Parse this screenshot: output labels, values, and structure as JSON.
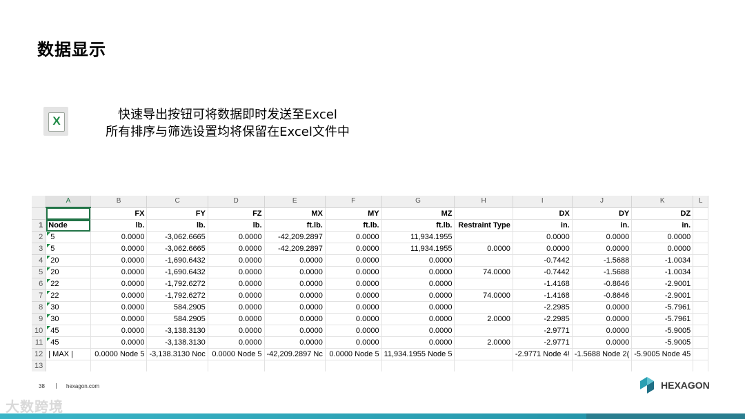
{
  "slide": {
    "title": "数据显示",
    "desc_line1": "快速导出按钮可将数据即时发送至Excel",
    "desc_line2": "所有排序与筛选设置均将保留在Excel文件中",
    "page_number": "38",
    "separator": "|",
    "site": "hexagon.com",
    "brand": "HEXAGON",
    "watermark": "大数跨境",
    "excel_icon_letter": "X"
  },
  "spreadsheet": {
    "column_letters": [
      "A",
      "B",
      "C",
      "D",
      "E",
      "F",
      "G",
      "H",
      "I",
      "J",
      "K",
      "L"
    ],
    "header_top": [
      "",
      "FX",
      "FY",
      "FZ",
      "MX",
      "MY",
      "MZ",
      "",
      "DX",
      "DY",
      "DZ",
      ""
    ],
    "header_units": [
      "Node",
      "lb.",
      "lb.",
      "lb.",
      "ft.lb.",
      "ft.lb.",
      "ft.lb.",
      "Restraint Type",
      "in.",
      "in.",
      "in.",
      ""
    ],
    "row_numbers": [
      "1",
      "2",
      "3",
      "4",
      "5",
      "6",
      "7",
      "8",
      "9",
      "10",
      "11",
      "12",
      "13"
    ],
    "rows": [
      [
        "5",
        "0.0000",
        "-3,062.6665",
        "0.0000",
        "-42,209.2897",
        "0.0000",
        "11,934.1955",
        "",
        "0.0000",
        "0.0000",
        "0.0000",
        ""
      ],
      [
        "5",
        "0.0000",
        "-3,062.6665",
        "0.0000",
        "-42,209.2897",
        "0.0000",
        "11,934.1955",
        "0.0000",
        "0.0000",
        "0.0000",
        "0.0000",
        ""
      ],
      [
        "20",
        "0.0000",
        "-1,690.6432",
        "0.0000",
        "0.0000",
        "0.0000",
        "0.0000",
        "",
        "-0.7442",
        "-1.5688",
        "-1.0034",
        ""
      ],
      [
        "20",
        "0.0000",
        "-1,690.6432",
        "0.0000",
        "0.0000",
        "0.0000",
        "0.0000",
        "74.0000",
        "-0.7442",
        "-1.5688",
        "-1.0034",
        ""
      ],
      [
        "22",
        "0.0000",
        "-1,792.6272",
        "0.0000",
        "0.0000",
        "0.0000",
        "0.0000",
        "",
        "-1.4168",
        "-0.8646",
        "-2.9001",
        ""
      ],
      [
        "22",
        "0.0000",
        "-1,792.6272",
        "0.0000",
        "0.0000",
        "0.0000",
        "0.0000",
        "74.0000",
        "-1.4168",
        "-0.8646",
        "-2.9001",
        ""
      ],
      [
        "30",
        "0.0000",
        "584.2905",
        "0.0000",
        "0.0000",
        "0.0000",
        "0.0000",
        "",
        "-2.2985",
        "0.0000",
        "-5.7961",
        ""
      ],
      [
        "30",
        "0.0000",
        "584.2905",
        "0.0000",
        "0.0000",
        "0.0000",
        "0.0000",
        "2.0000",
        "-2.2985",
        "0.0000",
        "-5.7961",
        ""
      ],
      [
        "45",
        "0.0000",
        "-3,138.3130",
        "0.0000",
        "0.0000",
        "0.0000",
        "0.0000",
        "",
        "-2.9771",
        "0.0000",
        "-5.9005",
        ""
      ],
      [
        "45",
        "0.0000",
        "-3,138.3130",
        "0.0000",
        "0.0000",
        "0.0000",
        "0.0000",
        "2.0000",
        "-2.9771",
        "0.0000",
        "-5.9005",
        ""
      ]
    ],
    "max_row": [
      "| MAX |",
      "0.0000 Node 5",
      "-3,138.3130 Noc",
      "0.0000 Node 5",
      "-42,209.2897 Nc",
      "0.0000 Node 5",
      "11,934.1955 Node 5",
      "",
      "-2.9771 Node 4!",
      "-1.5688 Node 2(",
      "-5.9005 Node 45",
      ""
    ]
  },
  "colors": {
    "excel_green": "#217346",
    "brand_teal": "#2a9fb2"
  }
}
